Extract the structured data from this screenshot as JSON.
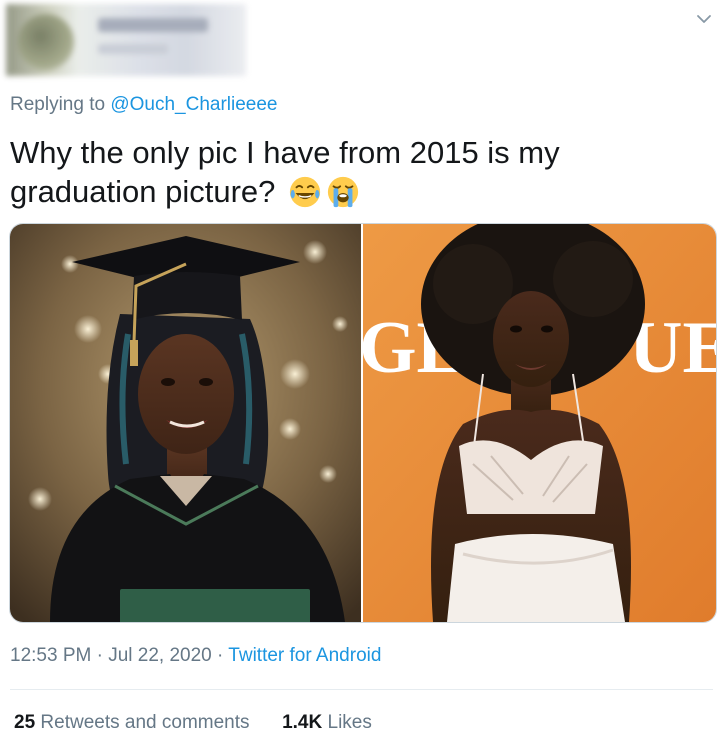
{
  "tweet": {
    "replying_prefix": "Replying to",
    "replying_to": "@Ouch_Charlieeee",
    "text": "Why the only pic I have from 2015 is my graduation picture?",
    "emojis": [
      "face-with-tears-of-joy-icon",
      "loudly-crying-face-icon"
    ],
    "images": [
      {
        "name": "graduation-photo"
      },
      {
        "name": "portrait-photo",
        "backdrop_letters_left": "GE",
        "backdrop_letters_right": "UE"
      }
    ],
    "time": "12:53 PM",
    "date": "Jul 22, 2020",
    "separator": "·",
    "app": "Twitter for Android",
    "retweets_count": "25",
    "retweets_label": "Retweets and comments",
    "likes_count": "1.4K",
    "likes_label": "Likes"
  },
  "colors": {
    "link": "#1b95e0",
    "secondary_text": "#657786",
    "primary_text": "#14171a",
    "divider": "#e6ecf0",
    "right_backdrop": "#e8893a"
  }
}
